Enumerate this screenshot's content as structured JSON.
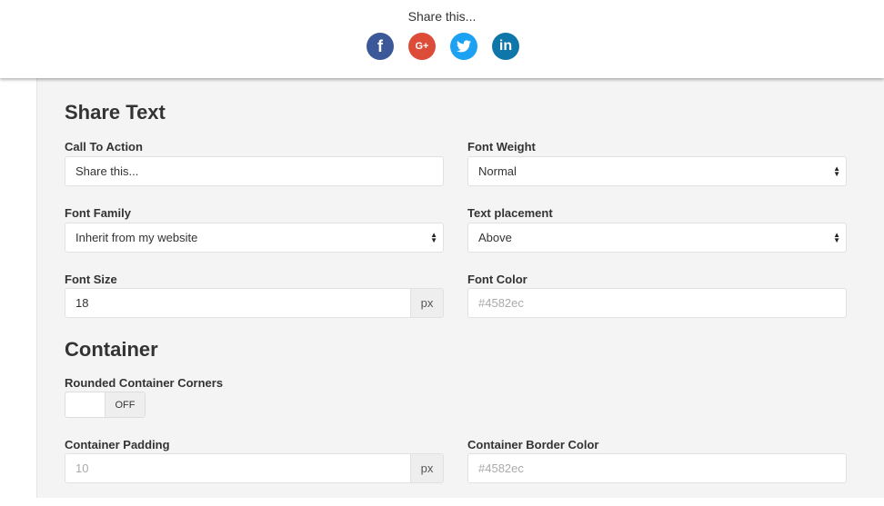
{
  "preview": {
    "call_to_action": "Share this...",
    "icons": [
      "facebook-icon",
      "google-plus-icon",
      "twitter-icon",
      "linkedin-icon"
    ],
    "icon_glyphs": {
      "facebook": "f",
      "google_plus": "G+",
      "linkedin": "in"
    },
    "colors": {
      "facebook": "#3b5998",
      "google_plus": "#dd4b39",
      "twitter": "#1da1f2",
      "linkedin": "#0e76a8"
    }
  },
  "share_text": {
    "heading": "Share Text",
    "call_to_action_label": "Call To Action",
    "call_to_action_value": "Share this...",
    "font_weight_label": "Font Weight",
    "font_weight_value": "Normal",
    "font_family_label": "Font Family",
    "font_family_value": "Inherit from my website",
    "text_placement_label": "Text placement",
    "text_placement_value": "Above",
    "font_size_label": "Font Size",
    "font_size_value": "18",
    "font_size_unit": "px",
    "font_color_label": "Font Color",
    "font_color_placeholder": "#4582ec"
  },
  "container": {
    "heading": "Container",
    "rounded_corners_label": "Rounded Container Corners",
    "rounded_corners_state": "OFF",
    "padding_label": "Container Padding",
    "padding_placeholder": "10",
    "padding_unit": "px",
    "border_color_label": "Container Border Color",
    "border_color_placeholder": "#4582ec"
  }
}
